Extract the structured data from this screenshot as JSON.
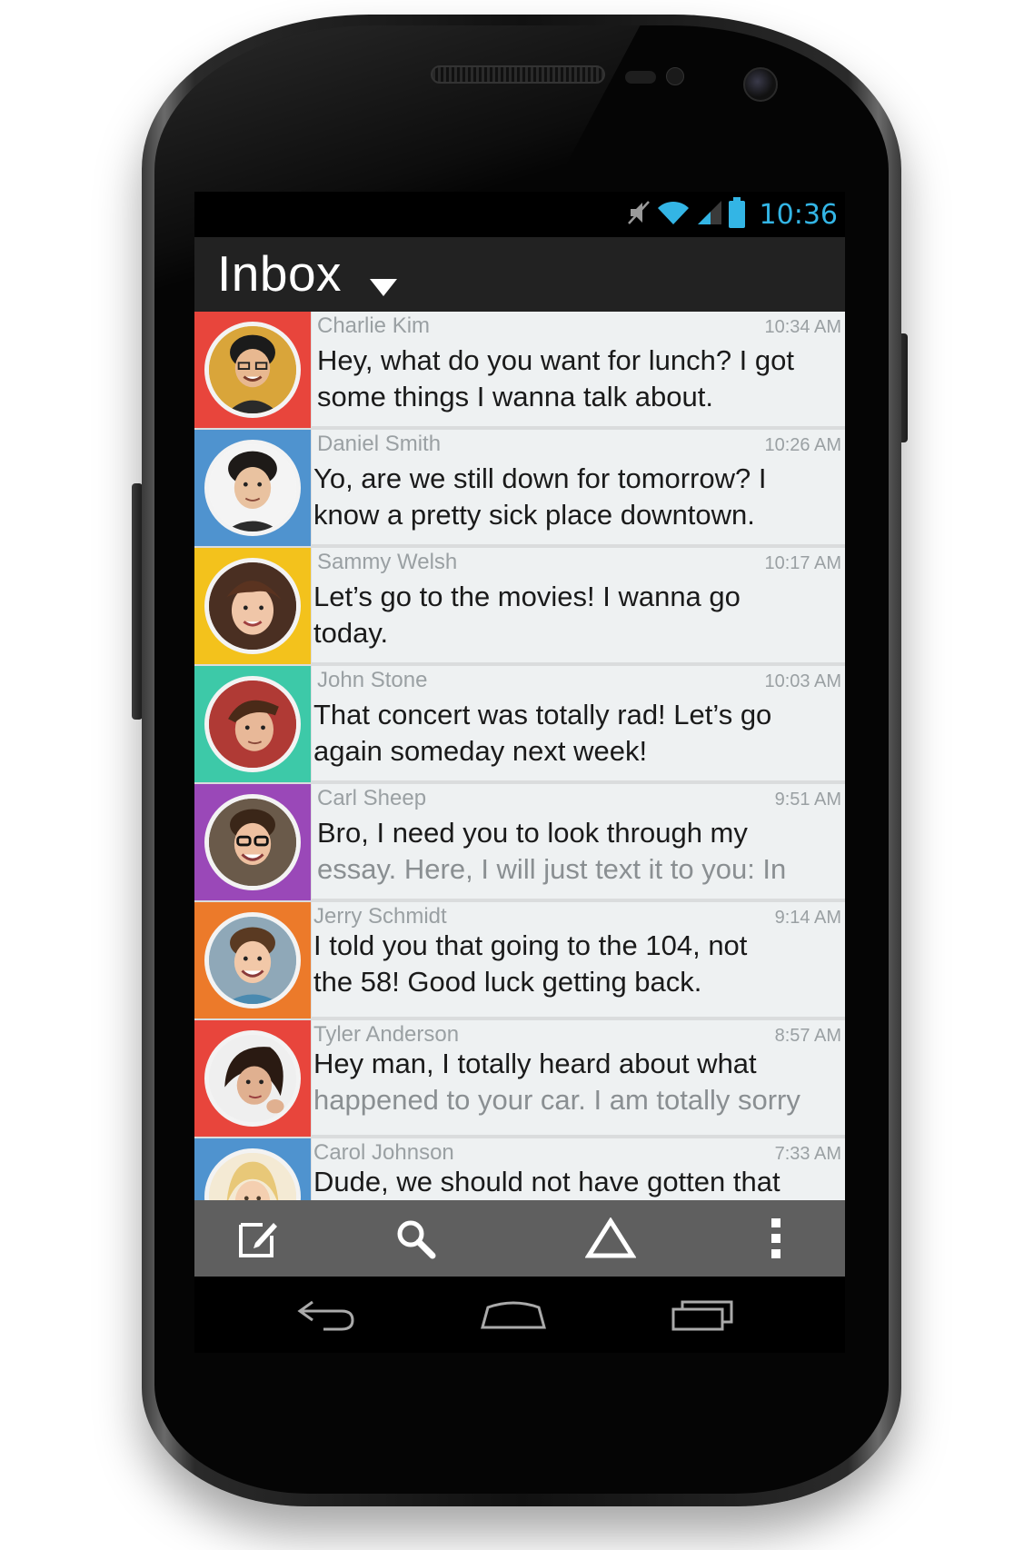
{
  "status_bar": {
    "time": "10:36",
    "icons": [
      "mute-icon",
      "wifi-icon",
      "signal-icon",
      "battery-icon"
    ],
    "accent_color": "#33b5e5"
  },
  "action_bar": {
    "title": "Inbox"
  },
  "messages": [
    {
      "sender": "Charlie Kim",
      "time": "10:34 AM",
      "line1": "Hey, what do you want for lunch? I got",
      "line2": "some things I wanna talk about.",
      "color": "#e8453c"
    },
    {
      "sender": "Daniel Smith",
      "time": "10:26 AM",
      "line1": "Yo, are we still down for tomorrow? I",
      "line2": "know a pretty sick place downtown.",
      "color": "#4f93cf"
    },
    {
      "sender": "Sammy Welsh",
      "time": "10:17 AM",
      "line1": "Let’s go to the movies! I wanna go",
      "line2": "today.",
      "color": "#f3c21c"
    },
    {
      "sender": "John Stone",
      "time": "10:03 AM",
      "line1": "That concert was totally rad! Let’s go",
      "line2": "again someday next week!",
      "color": "#3dc9a8"
    },
    {
      "sender": "Carl Sheep",
      "time": "9:51 AM",
      "line1": "Bro, I need you to look through my",
      "line2": "essay. Here, I will just text it to you: In",
      "color": "#9a48b8"
    },
    {
      "sender": "Jerry Schmidt",
      "time": "9:14 AM",
      "line1": "I told you that going to the 104, not",
      "line2": "the 58! Good luck getting back.",
      "color": "#ec7a2a"
    },
    {
      "sender": "Tyler Anderson",
      "time": "8:57 AM",
      "line1": "Hey man, I totally heard about what",
      "line2": "happened to your car. I am totally sorry",
      "color": "#e8453c"
    },
    {
      "sender": "Carol Johnson",
      "time": "7:33 AM",
      "line1": "Dude, we should not have gotten that",
      "line2": "",
      "color": "#4f93cf"
    }
  ],
  "bottom_actions": [
    "compose-icon",
    "search-icon",
    "triangle-icon",
    "overflow-menu-icon"
  ],
  "nav_buttons": [
    "back-icon",
    "home-icon",
    "recent-apps-icon"
  ]
}
